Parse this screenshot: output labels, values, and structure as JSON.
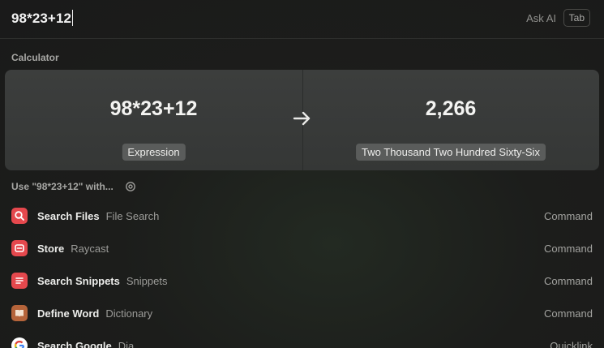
{
  "search": {
    "query": "98*23+12",
    "ask_ai_label": "Ask AI",
    "tab_key": "Tab"
  },
  "calculator": {
    "section_label": "Calculator",
    "expression": "98*23+12",
    "expression_tag": "Expression",
    "result": "2,266",
    "result_words": "Two Thousand Two Hundred Sixty-Six"
  },
  "use_with": {
    "label": "Use \"98*23+12\" with..."
  },
  "items": [
    {
      "title": "Search Files",
      "subtitle": "File Search",
      "type": "Command",
      "icon": "search-files-icon",
      "color": "#e5484d"
    },
    {
      "title": "Store",
      "subtitle": "Raycast",
      "type": "Command",
      "icon": "store-icon",
      "color": "#e5484d"
    },
    {
      "title": "Search Snippets",
      "subtitle": "Snippets",
      "type": "Command",
      "icon": "snippets-icon",
      "color": "#e5484d"
    },
    {
      "title": "Define Word",
      "subtitle": "Dictionary",
      "type": "Command",
      "icon": "dictionary-icon",
      "color": "#b5643a"
    },
    {
      "title": "Search Google",
      "subtitle": "Dia",
      "type": "Quicklink",
      "icon": "google-icon",
      "color": "#ffffff"
    }
  ]
}
